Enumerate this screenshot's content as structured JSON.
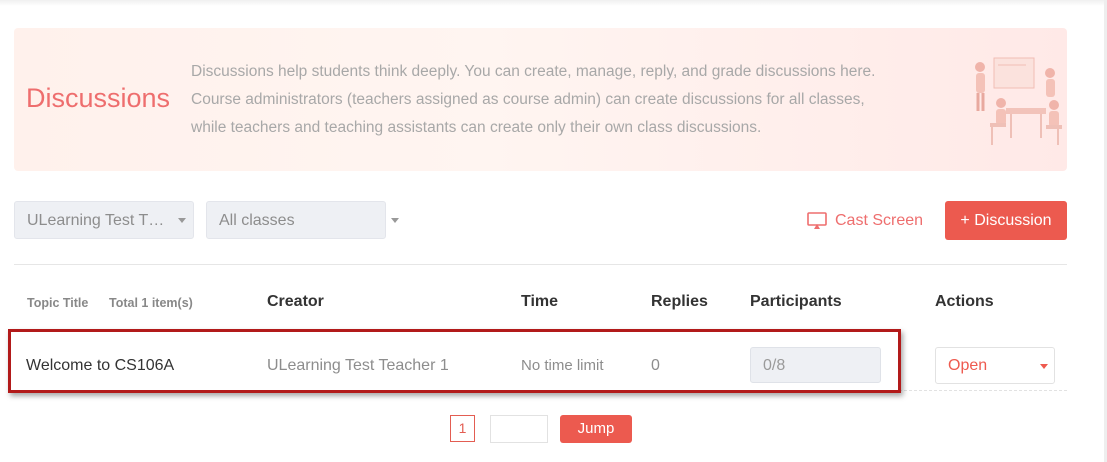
{
  "banner": {
    "title": "Discussions",
    "description_lines": [
      "Discussions help students think deeply. You can create, manage, reply, and grade discussions here.",
      "Course administrators (teachers assigned as course admin) can create discussions for all classes,",
      "while teachers and teaching assistants can create only their own class discussions."
    ]
  },
  "filters": {
    "course_select": "ULearning Test T…",
    "class_select": "All classes"
  },
  "toolbar": {
    "cast_screen_label": "Cast Screen",
    "add_discussion_label": "+ Discussion"
  },
  "table": {
    "headers": {
      "topic_title": "Topic Title",
      "total": "Total 1 item(s)",
      "creator": "Creator",
      "time": "Time",
      "replies": "Replies",
      "participants": "Participants",
      "actions": "Actions"
    },
    "rows": [
      {
        "title": "Welcome to CS106A",
        "creator": "ULearning Test Teacher 1",
        "time": "No time limit",
        "replies": "0",
        "participants": "0/8",
        "action": "Open"
      }
    ]
  },
  "pagination": {
    "current_page": "1",
    "jump_label": "Jump"
  },
  "colors": {
    "accent": "#ec5a4f",
    "banner_title": "#ee6e6e",
    "highlight_border": "#b21a1a"
  }
}
